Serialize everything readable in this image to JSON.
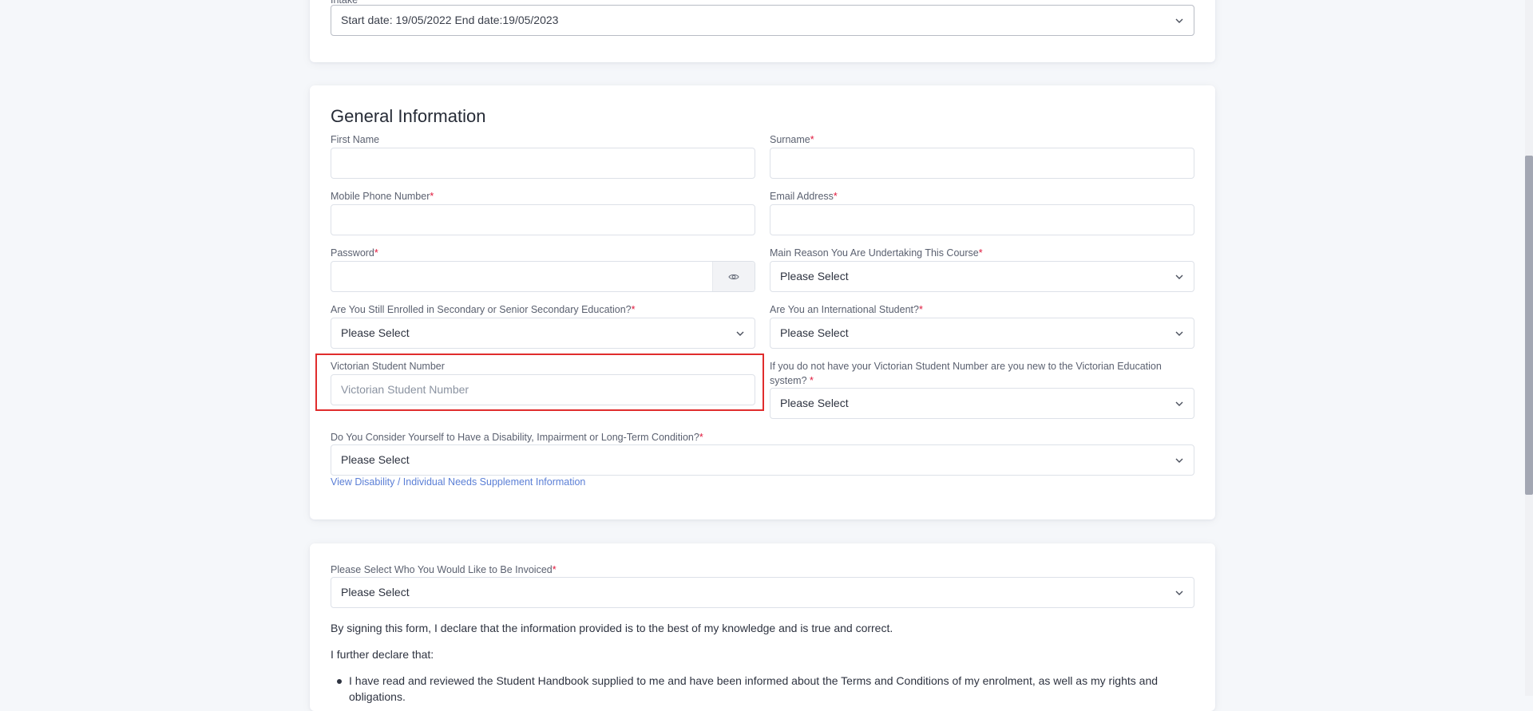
{
  "intake": {
    "label": "Intake",
    "value": "Start date: 19/05/2022 End date:19/05/2023"
  },
  "general": {
    "title": "General Information",
    "first_name": {
      "label": "First Name"
    },
    "surname": {
      "label": "Surname",
      "required": "*"
    },
    "mobile": {
      "label": "Mobile Phone Number",
      "required": "*"
    },
    "email": {
      "label": "Email Address",
      "required": "*"
    },
    "password": {
      "label": "Password",
      "required": "*"
    },
    "main_reason": {
      "label": "Main Reason You Are Undertaking This Course",
      "required": "*",
      "value": "Please Select"
    },
    "still_enrolled": {
      "label": "Are You Still Enrolled in Secondary or Senior Secondary Education?",
      "required": "*",
      "value": "Please Select"
    },
    "international": {
      "label": "Are You an International Student?",
      "required": "*",
      "value": "Please Select"
    },
    "vsn": {
      "label": "Victorian Student Number",
      "placeholder": "Victorian Student Number"
    },
    "vsn_new": {
      "label_line1": "If you do not have your Victorian Student Number are you new to the Victorian Education",
      "label_line2": "system? ",
      "required": "*",
      "value": "Please Select"
    },
    "disability": {
      "label": "Do You Consider Yourself to Have a Disability, Impairment or Long-Term Condition?",
      "required": "*",
      "value": "Please Select"
    },
    "disability_link": "View Disability / Individual Needs Supplement Information"
  },
  "invoice": {
    "label": "Please Select Who You Would Like to Be Invoiced",
    "required": "*",
    "value": "Please Select",
    "declaration": "By signing this form, I declare that the information provided is to the best of my knowledge and is true and correct.",
    "further": "I further declare that:",
    "bullet1": "I have read and reviewed the Student Handbook supplied to me and have been informed about the Terms and Conditions of my enrolment, as well as my rights and",
    "bullet1_cont": "obligations."
  },
  "icons": {
    "chevron": "chevron-down-icon",
    "eye": "eye-icon"
  },
  "colors": {
    "required": "#e0183c",
    "highlight": "#e02c2c",
    "link": "#5b7fd6"
  }
}
